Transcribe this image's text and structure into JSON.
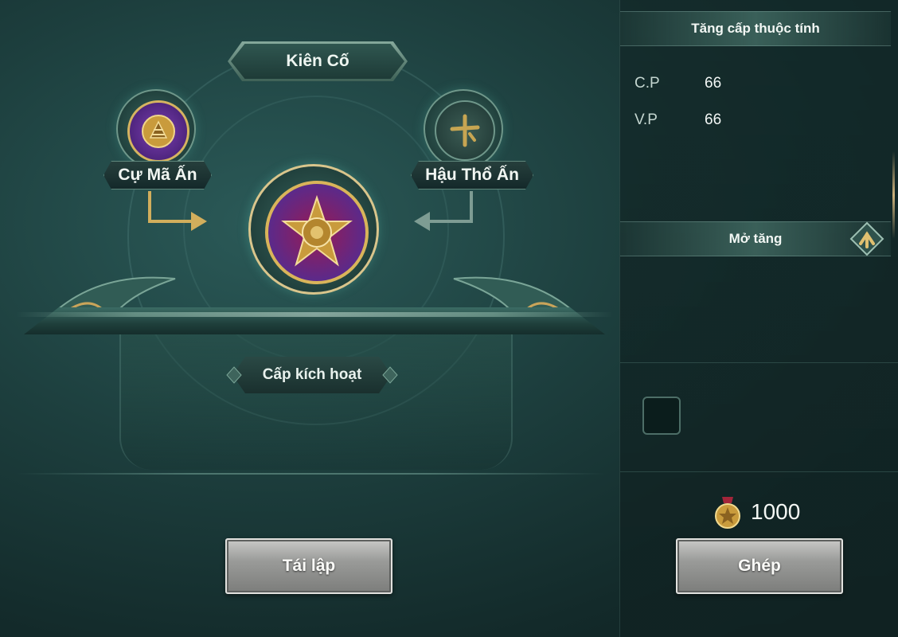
{
  "stage": {
    "title": "Kiên Cố",
    "left_seal": {
      "name": "Cự Mã Ấn",
      "icon": "cu-ma-seal-icon"
    },
    "right_seal": {
      "name": "Hậu Thổ Ấn",
      "icon": "hau-tho-seal-icon"
    },
    "center_seal": {
      "icon": "kien-co-seal-icon"
    },
    "level_label": "Cấp kích hoạt",
    "reset_button": "Tái lập"
  },
  "panel": {
    "attributes_header": "Tăng cấp thuộc tính",
    "stats": [
      {
        "label": "C.P",
        "value": "66"
      },
      {
        "label": "V.P",
        "value": "66"
      }
    ],
    "unlock_header": "Mở tăng",
    "currency": {
      "amount": "1000",
      "icon": "gold-medal-icon"
    },
    "combine_button": "Ghép"
  },
  "colors": {
    "background": "#1d3f3e",
    "gold": "#d9b45a",
    "purple": "#5b2a8a",
    "magenta": "#9a1a52",
    "button_stone": "#9a9b99"
  }
}
